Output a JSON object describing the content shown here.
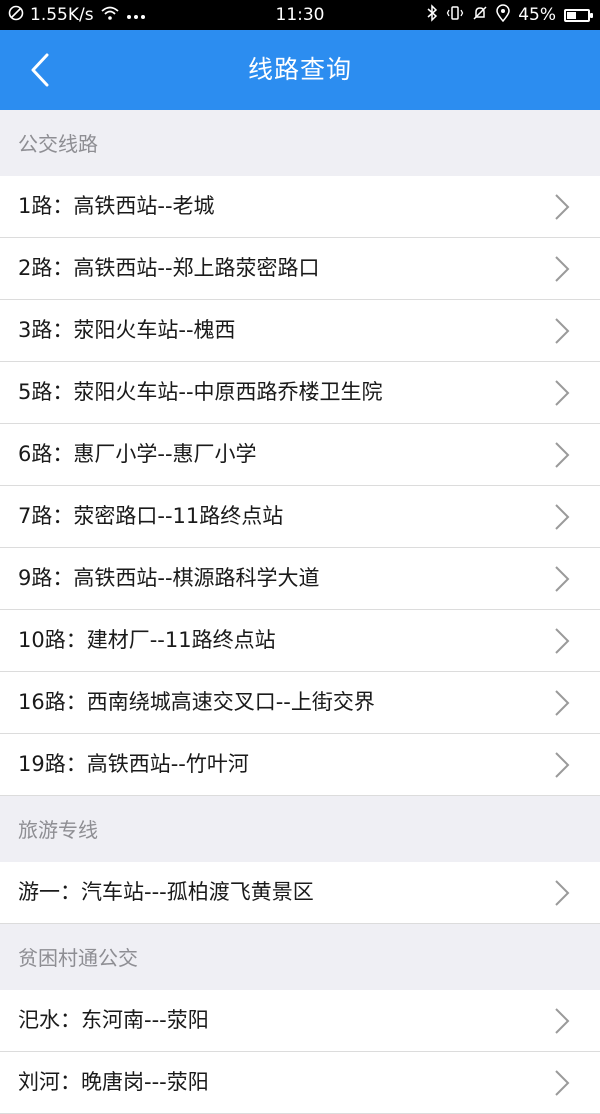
{
  "status_bar": {
    "speed": "1.55K/s",
    "time": "11:30",
    "battery": "45%",
    "battery_level": 0.45
  },
  "nav": {
    "title": "线路查询"
  },
  "sections": [
    {
      "header": "公交线路",
      "items": [
        "1路：高铁西站--老城",
        "2路：高铁西站--郑上路荥密路口",
        "3路：荥阳火车站--槐西",
        "5路：荥阳火车站--中原西路乔楼卫生院",
        "6路：惠厂小学--惠厂小学",
        "7路：荥密路口--11路终点站",
        "9路：高铁西站--棋源路科学大道",
        "10路：建材厂--11路终点站",
        "16路：西南绕城高速交叉口--上街交界",
        "19路：高铁西站--竹叶河"
      ]
    },
    {
      "header": "旅游专线",
      "items": [
        "游一：汽车站---孤柏渡飞黄景区"
      ]
    },
    {
      "header": "贫困村通公交",
      "items": [
        "汜水：东河南---荥阳",
        "刘河：晚唐岗---荥阳"
      ]
    }
  ]
}
